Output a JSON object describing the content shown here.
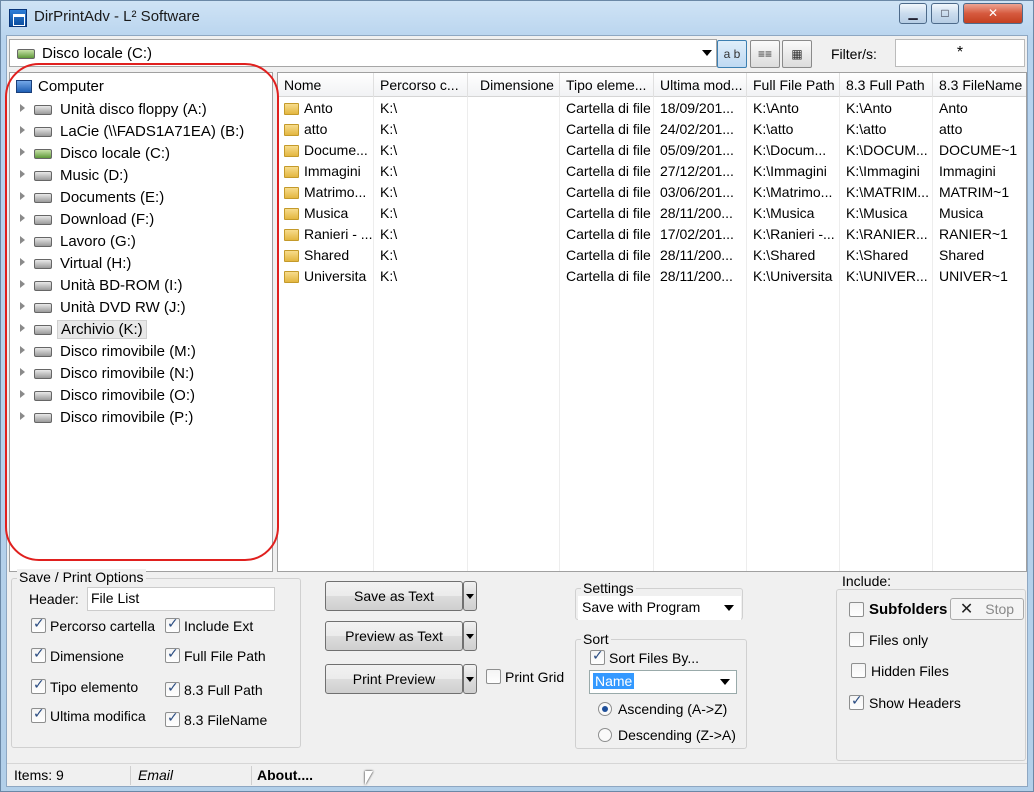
{
  "window": {
    "title": "DirPrintAdv - L² Software",
    "minimize_glyph": "▁",
    "maximize_glyph": "□",
    "close_glyph": "✕"
  },
  "toolbar": {
    "path_value": "Disco locale (C:)",
    "view_buttons": [
      "a b",
      "≡≡",
      "▦"
    ],
    "filter_label": "Filter/s:",
    "filter_value": "*"
  },
  "tree": {
    "root": "Computer",
    "items": [
      {
        "label": "Unità disco floppy (A:)",
        "icon": "floppy-drive-icon"
      },
      {
        "label": "LaCie (\\\\FADS1A71EA) (B:)",
        "icon": "network-drive-icon"
      },
      {
        "label": "Disco locale (C:)",
        "icon": "local-drive-icon"
      },
      {
        "label": "Music (D:)",
        "icon": "hard-drive-icon"
      },
      {
        "label": "Documents (E:)",
        "icon": "hard-drive-icon"
      },
      {
        "label": "Download (F:)",
        "icon": "hard-drive-icon"
      },
      {
        "label": "Lavoro (G:)",
        "icon": "hard-drive-icon"
      },
      {
        "label": "Virtual (H:)",
        "icon": "hard-drive-icon"
      },
      {
        "label": "Unità BD-ROM (I:)",
        "icon": "optical-drive-icon"
      },
      {
        "label": "Unità DVD RW (J:)",
        "icon": "optical-drive-icon"
      },
      {
        "label": "Archivio (K:)",
        "icon": "hard-drive-icon",
        "selected": true
      },
      {
        "label": "Disco rimovibile (M:)",
        "icon": "removable-drive-icon"
      },
      {
        "label": "Disco rimovibile (N:)",
        "icon": "removable-drive-icon"
      },
      {
        "label": "Disco rimovibile (O:)",
        "icon": "removable-drive-icon"
      },
      {
        "label": "Disco rimovibile (P:)",
        "icon": "removable-drive-icon"
      }
    ]
  },
  "list": {
    "columns": [
      "Nome",
      "Percorso c...",
      "Dimensione",
      "Tipo eleme...",
      "Ultima mod...",
      "Full File Path",
      "8.3 Full Path",
      "8.3 FileName"
    ],
    "rows": [
      [
        "Anto",
        "K:\\",
        "",
        "Cartella di file",
        "18/09/201...",
        "K:\\Anto",
        "K:\\Anto",
        "Anto"
      ],
      [
        "atto",
        "K:\\",
        "",
        "Cartella di file",
        "24/02/201...",
        "K:\\atto",
        "K:\\atto",
        "atto"
      ],
      [
        "Docume...",
        "K:\\",
        "",
        "Cartella di file",
        "05/09/201...",
        "K:\\Docum...",
        "K:\\DOCUM...",
        "DOCUME~1"
      ],
      [
        "Immagini",
        "K:\\",
        "",
        "Cartella di file",
        "27/12/201...",
        "K:\\Immagini",
        "K:\\Immagini",
        "Immagini"
      ],
      [
        "Matrimo...",
        "K:\\",
        "",
        "Cartella di file",
        "03/06/201...",
        "K:\\Matrimo...",
        "K:\\MATRIM...",
        "MATRIM~1"
      ],
      [
        "Musica",
        "K:\\",
        "",
        "Cartella di file",
        "28/11/200...",
        "K:\\Musica",
        "K:\\Musica",
        "Musica"
      ],
      [
        "Ranieri - ...",
        "K:\\",
        "",
        "Cartella di file",
        "17/02/201...",
        "K:\\Ranieri -...",
        "K:\\RANIER...",
        "RANIER~1"
      ],
      [
        "Shared",
        "K:\\",
        "",
        "Cartella di file",
        "28/11/200...",
        "K:\\Shared",
        "K:\\Shared",
        "Shared"
      ],
      [
        "Universita",
        "K:\\",
        "",
        "Cartella di file",
        "28/11/200...",
        "K:\\Universita",
        "K:\\UNIVER...",
        "UNIVER~1"
      ]
    ]
  },
  "options": {
    "group_title": "Save / Print Options",
    "header_label": "Header:",
    "header_value": "File List",
    "left_checks": [
      {
        "label": "Percorso cartella",
        "checked": true
      },
      {
        "label": "Dimensione",
        "checked": true
      },
      {
        "label": "Tipo elemento",
        "checked": true
      },
      {
        "label": "Ultima modifica",
        "checked": true
      }
    ],
    "right_checks": [
      {
        "label": "Include Ext",
        "checked": true
      },
      {
        "label": "Full File Path",
        "checked": true
      },
      {
        "label": "8.3 Full Path",
        "checked": true
      },
      {
        "label": "8.3 FileName",
        "checked": true
      }
    ]
  },
  "actions": {
    "save_as_text": "Save as Text",
    "preview_as_text": "Preview as Text",
    "print_preview": "Print Preview",
    "print_grid": "Print Grid",
    "print_grid_checked": false
  },
  "settings": {
    "title": "Settings",
    "value": "Save with Program"
  },
  "sort": {
    "title": "Sort",
    "sort_files_by": "Sort Files By...",
    "sort_files_by_checked": true,
    "sort_field": "Name",
    "ascending": "Ascending (A->Z)",
    "descending": "Descending (Z->A)",
    "selected": "ascending"
  },
  "include": {
    "title": "Include:",
    "subfolders": "Subfolders",
    "subfolders_checked": false,
    "stop": "Stop",
    "files_only": "Files only",
    "files_only_checked": false,
    "hidden_files": "Hidden Files",
    "hidden_files_checked": false,
    "show_headers": "Show Headers",
    "show_headers_checked": true
  },
  "status": {
    "items": "Items: 9",
    "email": "Email",
    "about": "About...."
  }
}
